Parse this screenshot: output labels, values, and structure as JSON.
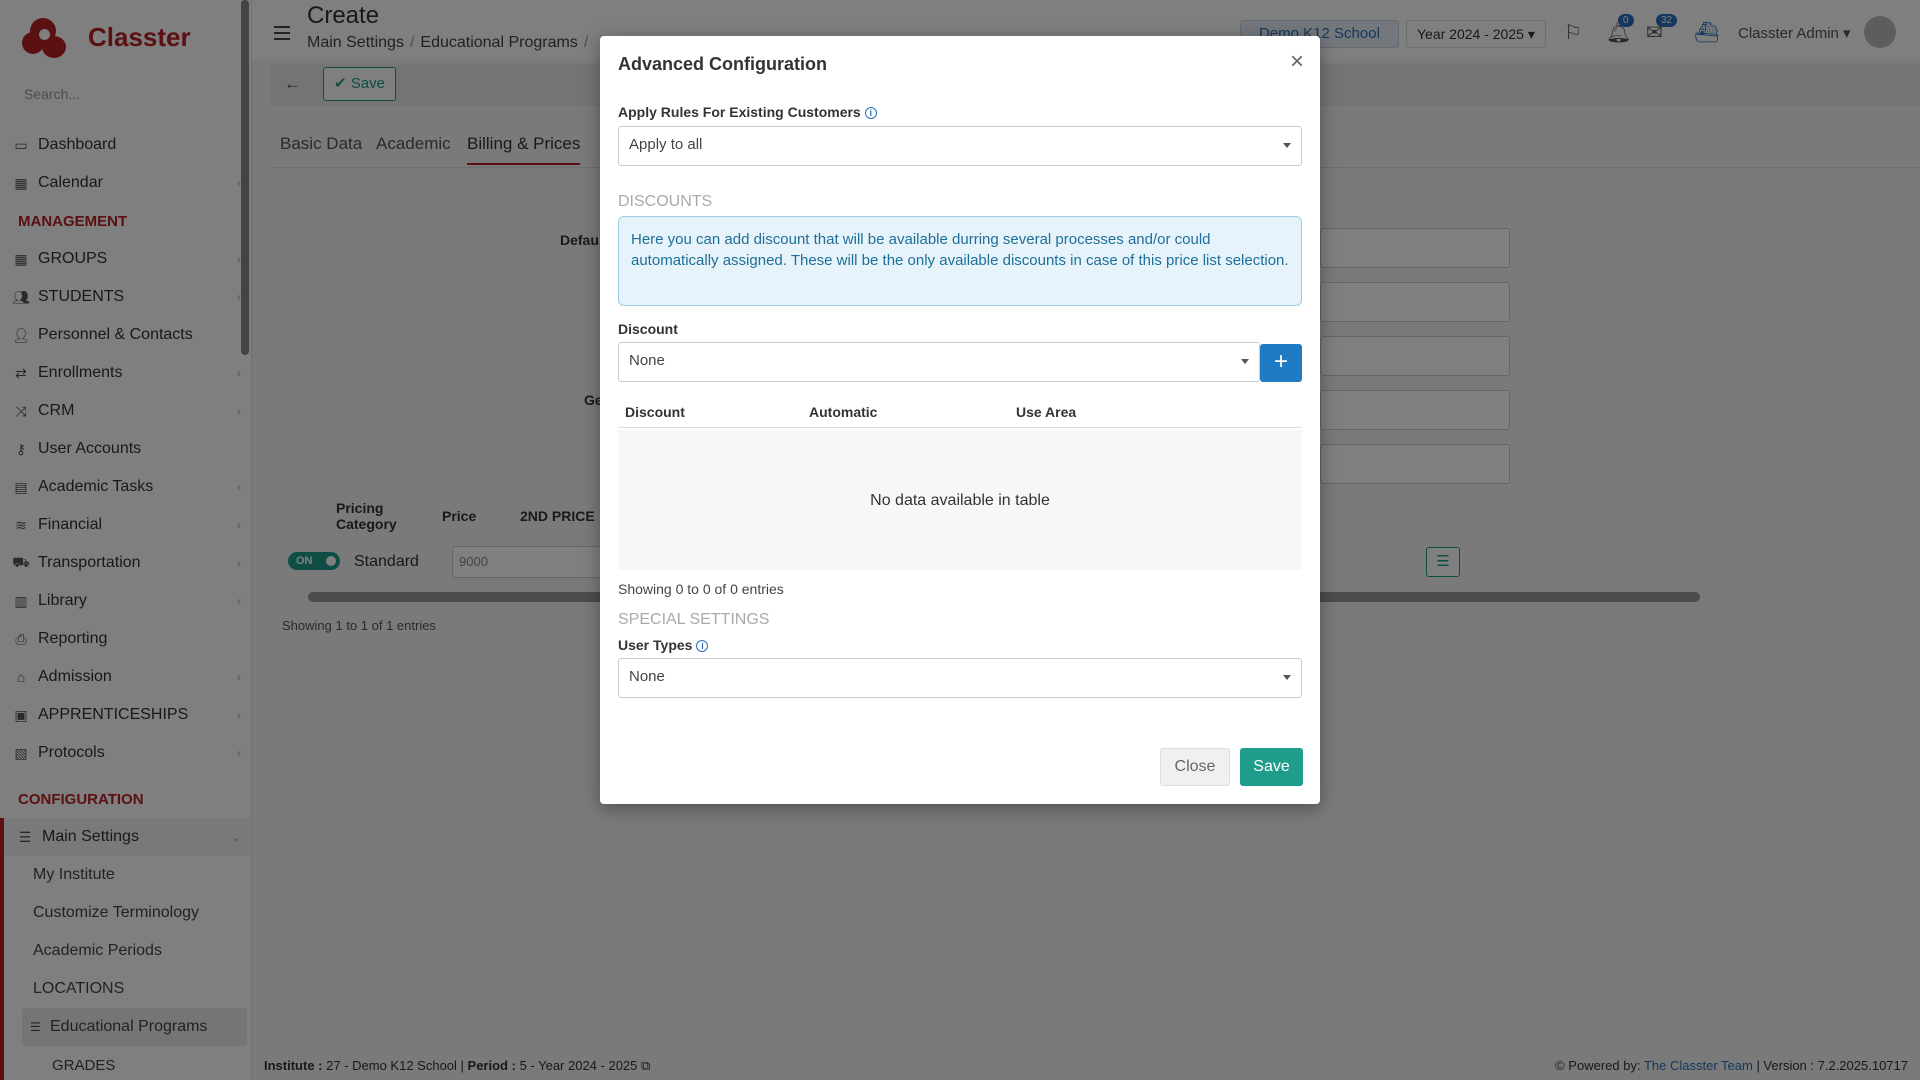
{
  "app": {
    "brand": "Classter",
    "search_placeholder": "Search..."
  },
  "sidebar": {
    "top_items": [
      {
        "label": "Dashboard",
        "icon": "laptop-icon"
      },
      {
        "label": "Calendar",
        "icon": "calendar-icon"
      }
    ],
    "management_title": "MANAGEMENT",
    "management_items": [
      {
        "label": "GROUPS",
        "icon": "groups-icon"
      },
      {
        "label": "STUDENTS",
        "icon": "students-icon"
      },
      {
        "label": "Personnel & Contacts",
        "icon": "person-icon"
      },
      {
        "label": "Enrollments",
        "icon": "exchange-icon"
      },
      {
        "label": "CRM",
        "icon": "crm-icon"
      },
      {
        "label": "User Accounts",
        "icon": "key-icon"
      },
      {
        "label": "Academic Tasks",
        "icon": "tasks-icon"
      },
      {
        "label": "Financial",
        "icon": "money-icon"
      },
      {
        "label": "Transportation",
        "icon": "bus-icon"
      },
      {
        "label": "Library",
        "icon": "library-icon"
      },
      {
        "label": "Reporting",
        "icon": "print-icon"
      },
      {
        "label": "Admission",
        "icon": "institution-icon"
      },
      {
        "label": "APPRENTICESHIPS",
        "icon": "box-icon"
      },
      {
        "label": "Protocols",
        "icon": "protocols-icon"
      }
    ],
    "configuration_title": "CONFIGURATION",
    "main_settings_label": "Main Settings",
    "sub_items": [
      "My Institute",
      "Customize Terminology",
      "Academic Periods",
      "LOCATIONS"
    ],
    "active_sub_item": "Educational Programs",
    "sub_sub_item": "GRADES"
  },
  "header": {
    "title": "Create",
    "breadcrumb": [
      "Main Settings",
      "Educational Programs"
    ],
    "school": "Demo K12 School",
    "year": "Year 2024 - 2025",
    "notifications_count": "0",
    "messages_count": "32",
    "user": "Classter Admin"
  },
  "page": {
    "save_label": "Save",
    "tabs": [
      "Basic Data",
      "Academic",
      "Billing & Prices"
    ],
    "active_tab": "Billing & Prices",
    "ghost_label_1": "Defau",
    "ghost_label_2": "Ge",
    "table_headers": [
      "Pricing Category",
      "Price",
      "2ND PRICE"
    ],
    "row": {
      "toggle": "ON",
      "category": "Standard",
      "price": "9000"
    },
    "showing": "Showing 1 to 1 of 1 entries"
  },
  "modal": {
    "title": "Advanced Configuration",
    "apply_rules_label": "Apply Rules For Existing Customers",
    "apply_rules_value": "Apply to all",
    "discounts_section": "DISCOUNTS",
    "discounts_info": "Here you can add discount that will be available durring several processes and/or could automatically assigned. These will be the only available discounts in case of this price list selection.",
    "discount_label": "Discount",
    "discount_value": "None",
    "add_label": "+",
    "table_headers": [
      "Discount",
      "Automatic",
      "Use Area"
    ],
    "empty_text": "No data available in table",
    "showing": "Showing 0 to 0 of 0 entries",
    "special_section": "SPECIAL SETTINGS",
    "user_types_label": "User Types",
    "user_types_value": "None",
    "close_label": "Close",
    "save_label": "Save"
  },
  "footer": {
    "institute_label": "Institute :",
    "institute_value": "27 - Demo K12 School",
    "period_label": "Period :",
    "period_value": "5 - Year 2024 - 2025",
    "powered_label": "Powered by:",
    "powered_link": "The Classter Team",
    "version": "| Version : 7.2.2025.10717"
  }
}
